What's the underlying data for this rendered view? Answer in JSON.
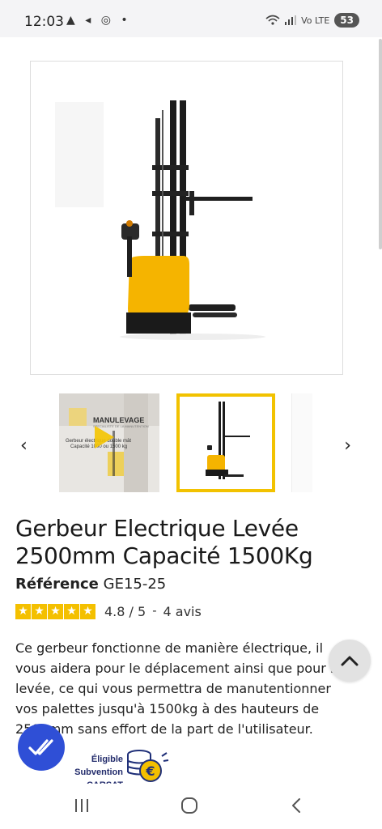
{
  "status_bar": {
    "time": "12:03",
    "icons": "▲ ◂ ◎ •",
    "signal": "Vo LTE",
    "battery": "53"
  },
  "gallery": {
    "thumb1_brand": "MANULEVAGE",
    "thumb1_subtitle": "SPECIALISTE DE LA MANUTENTION",
    "thumb1_caption1": "Gerbeur électrique double mât",
    "thumb1_caption2": "Capacité 1000 ou 1500 kg"
  },
  "product": {
    "title": "Gerbeur Electrique Levée 2500mm Capacité 1500Kg",
    "reference_label": "Référence",
    "reference_value": "GE15-25",
    "rating_value": "4.8 / 5",
    "rating_separator": "-",
    "reviews_count": "4 avis",
    "rating_stars": 5,
    "description": "Ce gerbeur fonctionne de manière électrique, il vous aidera pour le déplacement ainsi que pour la levée, ce qui vous permettra de manutentionner vos palettes jusqu'à 1500kg à des hauteurs de 2500mm sans effort de la part de l'utilisateur."
  },
  "subvention": {
    "line1": "Éligible Subvention",
    "line2": "CARSAT"
  },
  "colors": {
    "accent_yellow": "#f2c200",
    "badge_blue": "#2f4fd6"
  }
}
